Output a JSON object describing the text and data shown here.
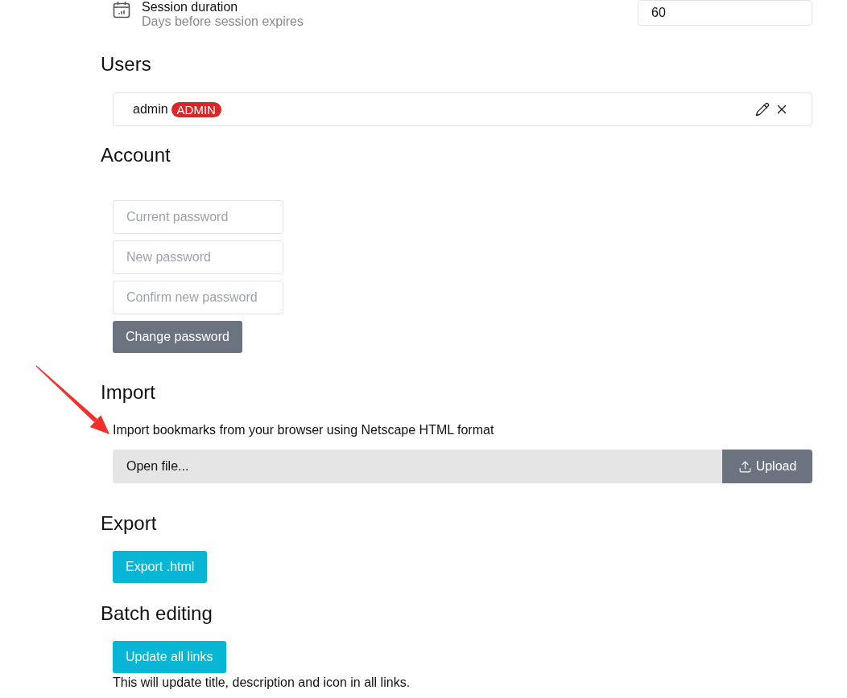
{
  "session": {
    "title": "Session duration",
    "description": "Days before session expires",
    "value": "60"
  },
  "users": {
    "heading": "Users",
    "items": [
      {
        "name": "admin",
        "badge": "ADMIN"
      }
    ]
  },
  "account": {
    "heading": "Account",
    "fields": [
      {
        "placeholder": "Current password"
      },
      {
        "placeholder": "New password"
      },
      {
        "placeholder": "Confirm new password"
      }
    ],
    "button": "Change password"
  },
  "import": {
    "heading": "Import",
    "description": "Import bookmarks from your browser using Netscape HTML format",
    "file_field": "Open file...",
    "button": "Upload"
  },
  "export": {
    "heading": "Export",
    "button": "Export .html"
  },
  "batch_editing": {
    "heading": "Batch editing",
    "button": "Update all links",
    "note": "This will update title, description and icon in all links."
  }
}
